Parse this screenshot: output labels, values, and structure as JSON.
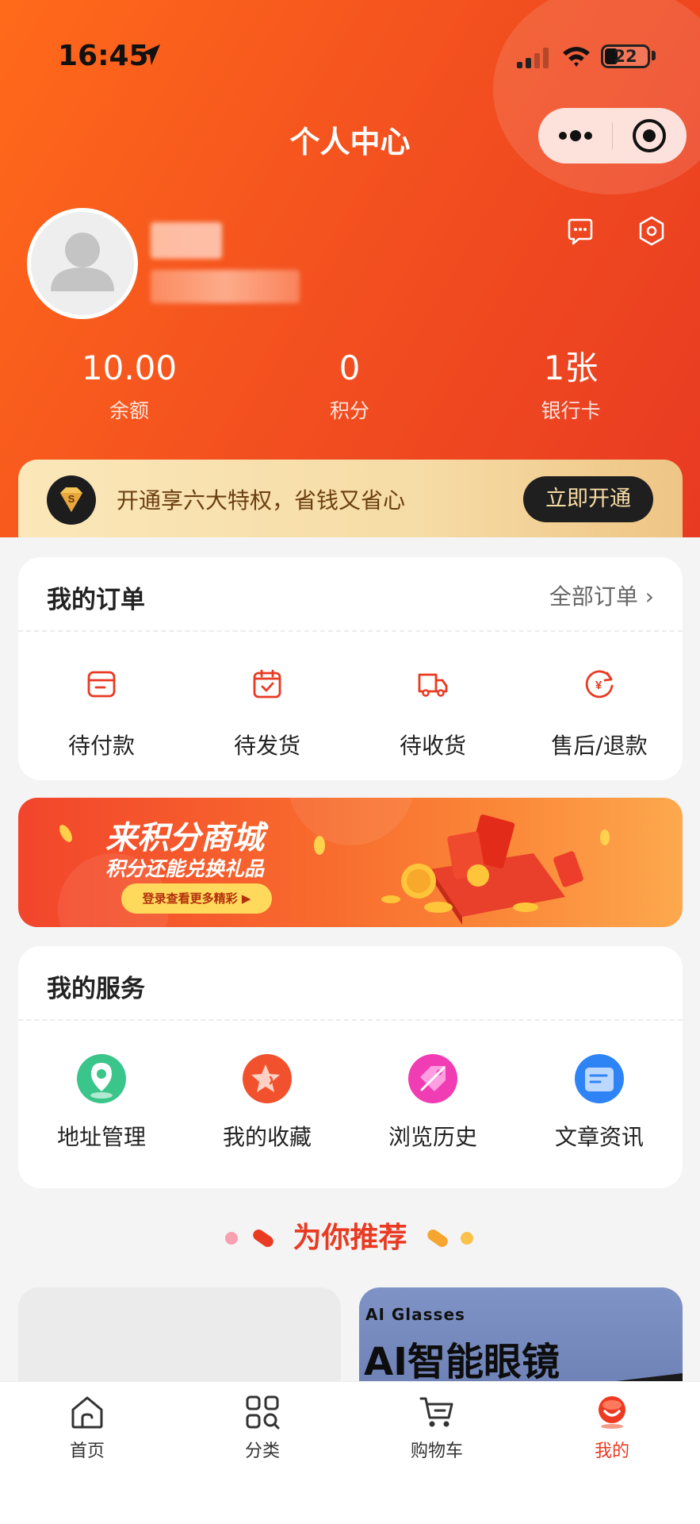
{
  "status_bar": {
    "time": "16:45",
    "battery": "22"
  },
  "header": {
    "title": "个人中心"
  },
  "stats": [
    {
      "value": "10.00",
      "label": "余额"
    },
    {
      "value": "0",
      "label": "积分"
    },
    {
      "value": "1张",
      "label": "银行卡"
    }
  ],
  "vip": {
    "text": "开通享六大特权，省钱又省心",
    "button": "立即开通",
    "badge": "S"
  },
  "orders": {
    "title": "我的订单",
    "all_link": "全部订单 ›",
    "items": [
      {
        "label": "待付款",
        "icon": "wallet-icon"
      },
      {
        "label": "待发货",
        "icon": "box-icon"
      },
      {
        "label": "待收货",
        "icon": "truck-icon"
      },
      {
        "label": "售后/退款",
        "icon": "refund-icon"
      }
    ]
  },
  "banner": {
    "title": "来积分商城",
    "subtitle": "积分还能兑换礼品",
    "button": "登录查看更多精彩 ▶"
  },
  "services": {
    "title": "我的服务",
    "items": [
      {
        "label": "地址管理",
        "icon": "location-icon",
        "color": "#3ac58a"
      },
      {
        "label": "我的收藏",
        "icon": "star-icon",
        "color": "#f2512e"
      },
      {
        "label": "浏览历史",
        "icon": "history-icon",
        "color": "#f03db4"
      },
      {
        "label": "文章资讯",
        "icon": "article-icon",
        "color": "#2f84f5"
      }
    ]
  },
  "recommend": {
    "title": "为你推荐"
  },
  "products": [
    {
      "subtitle": "",
      "title": ""
    },
    {
      "subtitle": "AI Glasses",
      "title": "AI智能眼镜"
    }
  ],
  "tabbar": {
    "items": [
      {
        "label": "首页",
        "icon": "home-icon"
      },
      {
        "label": "分类",
        "icon": "category-icon"
      },
      {
        "label": "购物车",
        "icon": "cart-icon"
      },
      {
        "label": "我的",
        "icon": "profile-icon",
        "active": true
      }
    ],
    "active_color": "#e93a22"
  },
  "colors": {
    "accent": "#e93a22",
    "hero_start": "#ff6a1a",
    "hero_end": "#e83a22"
  }
}
